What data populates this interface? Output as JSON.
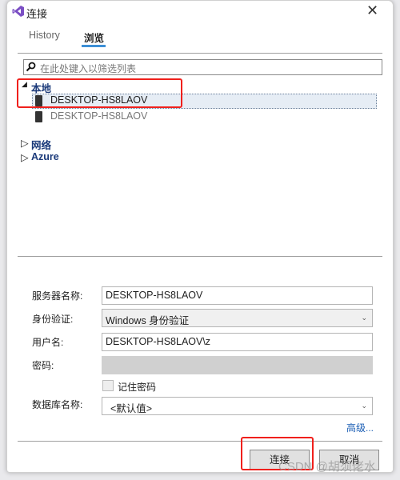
{
  "dialog": {
    "title": "连接",
    "close_icon": "close-icon",
    "logo": "visual-studio-logo"
  },
  "tabs": [
    {
      "label": "History",
      "active": false
    },
    {
      "label": "浏览",
      "active": true
    }
  ],
  "accent": "#3c8fd6",
  "search": {
    "placeholder": "在此处键入以筛选列表"
  },
  "tree": {
    "local": {
      "label": "本地",
      "expanded": true,
      "items": [
        {
          "label": "DESKTOP-HS8LAOV",
          "selected": true
        },
        {
          "label": "DESKTOP-HS8LAOV",
          "selected": false
        }
      ]
    },
    "network": {
      "label": "网络",
      "expanded": false
    },
    "azure": {
      "label": "Azure",
      "expanded": false
    }
  },
  "form": {
    "server_label": "服务器名称:",
    "server_value": "DESKTOP-HS8LAOV",
    "auth_label": "身份验证:",
    "auth_value": "Windows 身份验证",
    "user_label": "用户名:",
    "user_value": "DESKTOP-HS8LAOV\\z",
    "password_label": "密码:",
    "remember_label": "记住密码",
    "remember_checked": false,
    "db_label": "数据库名称:",
    "db_value": "<默认值>",
    "advanced": "高级..."
  },
  "buttons": {
    "connect": "连接",
    "cancel": "取消"
  },
  "watermark": "CSDN @胡须佬水"
}
